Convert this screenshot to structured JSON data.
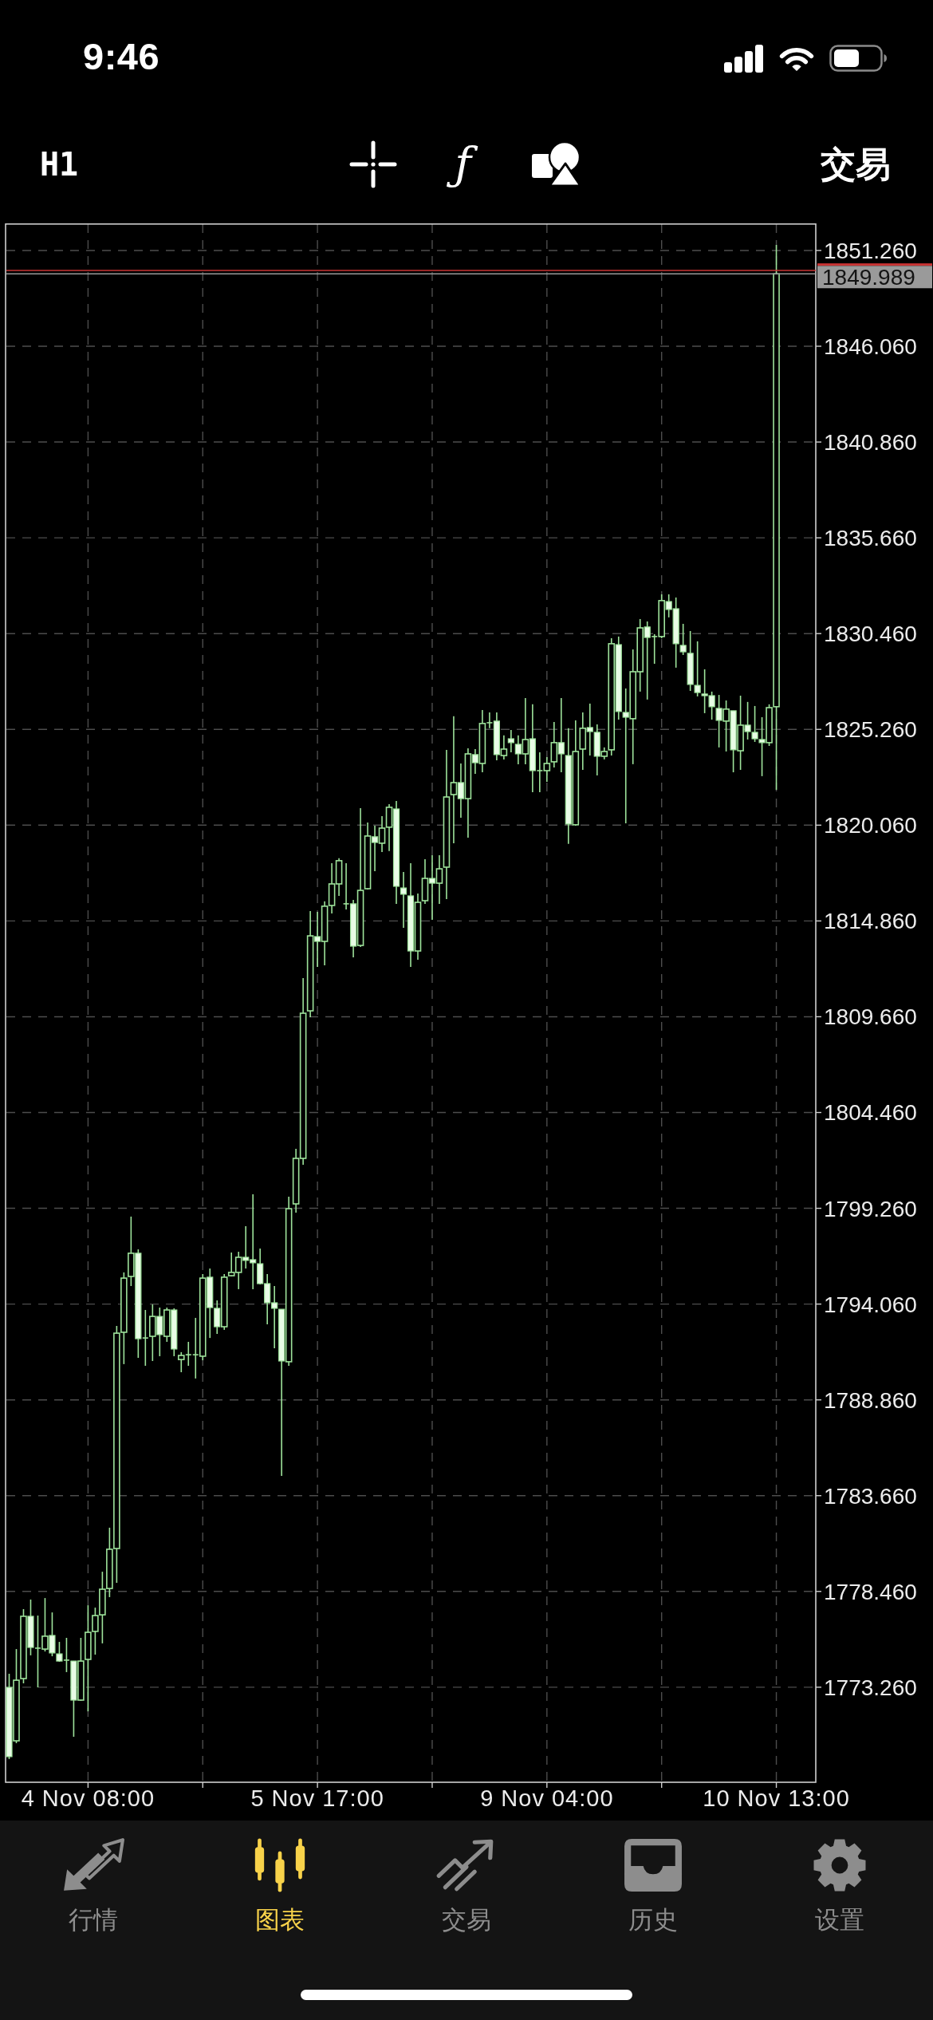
{
  "status_bar": {
    "time": "9:46"
  },
  "toolbar": {
    "timeframe": "H1",
    "tools": [
      {
        "kind": "crosshair"
      },
      {
        "kind": "indicators",
        "symbol": "ƒ"
      },
      {
        "kind": "objects"
      }
    ],
    "trade": "交易"
  },
  "chart": {
    "chart_data": {
      "type": "candlestick",
      "grid": true,
      "categories": [
        null,
        null,
        null,
        null,
        null,
        null,
        null,
        null,
        null,
        null,
        null,
        "4 Nov 08:00",
        null,
        null,
        null,
        null,
        null,
        null,
        null,
        null,
        null,
        null,
        null,
        null,
        null,
        null,
        null,
        null,
        null,
        null,
        null,
        null,
        null,
        null,
        null,
        null,
        null,
        null,
        null,
        null,
        null,
        null,
        null,
        "5 Nov 17:00",
        null,
        null,
        null,
        null,
        null,
        null,
        null,
        null,
        null,
        null,
        null,
        null,
        null,
        null,
        null,
        null,
        null,
        null,
        null,
        null,
        null,
        null,
        null,
        null,
        null,
        null,
        null,
        null,
        null,
        null,
        null,
        "9 Nov 04:00",
        null,
        null,
        null,
        null,
        null,
        null,
        null,
        null,
        null,
        null,
        null,
        null,
        null,
        null,
        null,
        null,
        null,
        null,
        null,
        null,
        null,
        null,
        null,
        null,
        null,
        null,
        null,
        null,
        null,
        null,
        null,
        "10 Nov 13:00",
        null,
        null,
        null,
        null,
        null
      ],
      "ohlc": [
        [
          1773.25,
          1773.99,
          1769.36,
          1769.49
        ],
        [
          1770.35,
          1775.33,
          1770.22,
          1773.64
        ],
        [
          1773.73,
          1777.5,
          1773.47,
          1777.11
        ],
        [
          1777.11,
          1778.02,
          1774.99,
          1775.42
        ],
        [
          1775.38,
          1777.15,
          1773.25,
          1775.38
        ],
        [
          1775.33,
          1778.1,
          1775.2,
          1776.03
        ],
        [
          1776.07,
          1777.32,
          1774.94,
          1775.12
        ],
        [
          1775.07,
          1775.72,
          1774.64,
          1774.68
        ],
        [
          1774.73,
          1775.94,
          1774.08,
          1774.73
        ],
        [
          1774.68,
          1774.68,
          1770.57,
          1772.56
        ],
        [
          1772.56,
          1775.94,
          1772.52,
          1774.68
        ],
        [
          1774.77,
          1777.71,
          1771.95,
          1776.24
        ],
        [
          1776.29,
          1777.58,
          1775.03,
          1777.15
        ],
        [
          1777.19,
          1779.53,
          1775.64,
          1778.58
        ],
        [
          1778.62,
          1781.92,
          1778.15,
          1780.75
        ],
        [
          1780.79,
          1792.87,
          1778.93,
          1792.48
        ],
        [
          1792.53,
          1795.78,
          1790.8,
          1795.47
        ],
        [
          1795.56,
          1798.81,
          1795.04,
          1796.82
        ],
        [
          1796.82,
          1797.03,
          1791.14,
          1792.18
        ],
        [
          1792.22,
          1793.74,
          1790.71,
          1792.22
        ],
        [
          1792.31,
          1794.04,
          1790.97,
          1793.39
        ],
        [
          1793.39,
          1793.87,
          1791.23,
          1792.4
        ],
        [
          1792.31,
          1793.87,
          1792.01,
          1793.74
        ],
        [
          1793.74,
          1793.83,
          1791.23,
          1791.62
        ],
        [
          1791.05,
          1791.45,
          1790.36,
          1791.27
        ],
        [
          1791.31,
          1792.01,
          1790.71,
          1791.31
        ],
        [
          1791.31,
          1793.31,
          1790.02,
          1791.31
        ],
        [
          1791.23,
          1795.69,
          1791.01,
          1795.47
        ],
        [
          1795.52,
          1795.99,
          1792.22,
          1793.87
        ],
        [
          1793.83,
          1794.26,
          1792.44,
          1792.83
        ],
        [
          1792.83,
          1795.69,
          1792.66,
          1795.52
        ],
        [
          1795.6,
          1796.86,
          1795.56,
          1795.78
        ],
        [
          1795.78,
          1796.9,
          1794.87,
          1796.6
        ],
        [
          1796.6,
          1798.29,
          1795.99,
          1796.43
        ],
        [
          1796.47,
          1800.02,
          1794.87,
          1796.3
        ],
        [
          1796.25,
          1797.08,
          1795.13,
          1795.17
        ],
        [
          1795.17,
          1795.69,
          1792.96,
          1794.13
        ],
        [
          1794.13,
          1795.04,
          1791.66,
          1793.83
        ],
        [
          1793.78,
          1793.78,
          1784.73,
          1790.97
        ],
        [
          1790.93,
          1799.89,
          1790.71,
          1799.24
        ],
        [
          1799.5,
          1802.49,
          1799.02,
          1801.97
        ],
        [
          1801.97,
          1811.76,
          1801.62,
          1809.85
        ],
        [
          1809.98,
          1815.4,
          1809.64,
          1814.05
        ],
        [
          1814.01,
          1815.35,
          1812.36,
          1813.75
        ],
        [
          1813.75,
          1815.93,
          1812.45,
          1815.66
        ],
        [
          1815.7,
          1817.99,
          1815.27,
          1816.87
        ],
        [
          1816.87,
          1818.26,
          1816.22,
          1818.13
        ],
        [
          1815.79,
          1817.99,
          1815.48,
          1815.79
        ],
        [
          1815.79,
          1816.0,
          1812.88,
          1813.49
        ],
        [
          1813.53,
          1820.98,
          1813.45,
          1816.52
        ],
        [
          1816.61,
          1820.2,
          1816.57,
          1819.47
        ],
        [
          1819.43,
          1820.03,
          1817.56,
          1819.12
        ],
        [
          1819.08,
          1820.55,
          1818.6,
          1819.9
        ],
        [
          1819.95,
          1821.2,
          1818.65,
          1821.03
        ],
        [
          1820.94,
          1821.37,
          1815.79,
          1816.74
        ],
        [
          1816.65,
          1817.52,
          1814.49,
          1816.31
        ],
        [
          1816.22,
          1817.99,
          1812.36,
          1813.23
        ],
        [
          1813.23,
          1816.35,
          1812.75,
          1815.87
        ],
        [
          1815.96,
          1818.21,
          1815.79,
          1817.17
        ],
        [
          1817.17,
          1818.43,
          1814.92,
          1816.91
        ],
        [
          1816.91,
          1818.43,
          1815.79,
          1817.69
        ],
        [
          1817.78,
          1824.15,
          1816.05,
          1821.59
        ],
        [
          1821.72,
          1825.97,
          1819.08,
          1822.37
        ],
        [
          1822.37,
          1823.41,
          1820.46,
          1821.5
        ],
        [
          1821.5,
          1824.23,
          1819.38,
          1823.93
        ],
        [
          1823.89,
          1824.19,
          1822.85,
          1823.45
        ],
        [
          1823.41,
          1826.31,
          1822.93,
          1825.58
        ],
        [
          1825.62,
          1826.18,
          1825.32,
          1825.62
        ],
        [
          1825.71,
          1826.18,
          1823.58,
          1823.89
        ],
        [
          1823.84,
          1824.93,
          1823.63,
          1824.19
        ],
        [
          1824.75,
          1825.23,
          1824.02,
          1824.54
        ],
        [
          1824.45,
          1824.93,
          1823.37,
          1823.93
        ],
        [
          1823.93,
          1826.96,
          1823.37,
          1824.71
        ],
        [
          1824.75,
          1826.62,
          1821.85,
          1823.02
        ],
        [
          1823.02,
          1824.02,
          1821.85,
          1823.02
        ],
        [
          1823.02,
          1823.76,
          1822.41,
          1823.41
        ],
        [
          1823.5,
          1825.66,
          1823.19,
          1824.54
        ],
        [
          1824.54,
          1826.96,
          1822.93,
          1823.93
        ],
        [
          1823.84,
          1825.32,
          1819.04,
          1820.12
        ],
        [
          1820.08,
          1825.75,
          1820.03,
          1824.06
        ],
        [
          1824.19,
          1826.18,
          1823.06,
          1825.32
        ],
        [
          1825.36,
          1826.66,
          1823.84,
          1825.14
        ],
        [
          1825.1,
          1825.53,
          1822.76,
          1823.8
        ],
        [
          1823.8,
          1824.28,
          1823.63,
          1824.06
        ],
        [
          1824.15,
          1830.21,
          1823.84,
          1829.91
        ],
        [
          1829.86,
          1830.3,
          1825.79,
          1826.23
        ],
        [
          1826.18,
          1827.48,
          1820.16,
          1825.92
        ],
        [
          1825.84,
          1829.6,
          1823.37,
          1828.39
        ],
        [
          1828.39,
          1831.25,
          1827.31,
          1830.77
        ],
        [
          1830.82,
          1831.12,
          1826.88,
          1830.25
        ],
        [
          1830.3,
          1830.43,
          1828.82,
          1830.3
        ],
        [
          1830.3,
          1832.59,
          1830.21,
          1832.25
        ],
        [
          1832.2,
          1832.59,
          1831.34,
          1831.77
        ],
        [
          1831.81,
          1832.42,
          1828.61,
          1829.91
        ],
        [
          1829.82,
          1830.99,
          1829.3,
          1829.47
        ],
        [
          1829.39,
          1830.6,
          1827.35,
          1827.7
        ],
        [
          1827.65,
          1830.04,
          1827.05,
          1827.26
        ],
        [
          1827.18,
          1828.52,
          1826.14,
          1827.09
        ],
        [
          1827.09,
          1827.31,
          1825.79,
          1826.49
        ],
        [
          1826.4,
          1827.13,
          1824.28,
          1825.75
        ],
        [
          1825.71,
          1826.83,
          1824.06,
          1826.36
        ],
        [
          1826.27,
          1826.27,
          1822.93,
          1824.15
        ],
        [
          1824.1,
          1827.09,
          1823.06,
          1825.49
        ],
        [
          1825.49,
          1826.75,
          1824.71,
          1825.14
        ],
        [
          1825.1,
          1826.53,
          1824.58,
          1824.75
        ],
        [
          1824.71,
          1825.92,
          1822.72,
          1824.54
        ],
        [
          1824.54,
          1826.62,
          1824.36,
          1826.44
        ],
        [
          1826.49,
          1851.56,
          1821.98,
          1849.99
        ],
        null,
        null,
        null,
        null,
        null
      ],
      "ylim": [
        1768.1,
        1852.73
      ],
      "yticks": [
        {
          "value": 1851.26,
          "label": "1851.260"
        },
        {
          "value": 1846.06,
          "label": "1846.060"
        },
        {
          "value": 1840.86,
          "label": "1840.860"
        },
        {
          "value": 1835.66,
          "label": "1835.660"
        },
        {
          "value": 1830.46,
          "label": "1830.460"
        },
        {
          "value": 1825.26,
          "label": "1825.260"
        },
        {
          "value": 1820.06,
          "label": "1820.060"
        },
        {
          "value": 1814.86,
          "label": "1814.860"
        },
        {
          "value": 1809.66,
          "label": "1809.660"
        },
        {
          "value": 1804.46,
          "label": "1804.460"
        },
        {
          "value": 1799.26,
          "label": "1799.260"
        },
        {
          "value": 1794.06,
          "label": "1794.060"
        },
        {
          "value": 1788.86,
          "label": "1788.860"
        },
        {
          "value": 1783.66,
          "label": "1783.660"
        },
        {
          "value": 1778.46,
          "label": "1778.460"
        },
        {
          "value": 1773.26,
          "label": "1773.260"
        }
      ],
      "ref_lines": [
        {
          "axis": "y",
          "value": 1850.17,
          "color": "#c93434"
        },
        {
          "axis": "y",
          "value": 1849.989,
          "color": "#9a9a9a",
          "label": "1849.989"
        }
      ]
    }
  },
  "tab_bar": {
    "tabs": [
      {
        "kind": "quotes",
        "label": "行情",
        "selected": false
      },
      {
        "kind": "chart",
        "label": "图表",
        "selected": true
      },
      {
        "kind": "trade",
        "label": "交易",
        "selected": false
      },
      {
        "kind": "history",
        "label": "历史",
        "selected": false
      },
      {
        "kind": "settings",
        "label": "设置",
        "selected": false
      }
    ]
  }
}
